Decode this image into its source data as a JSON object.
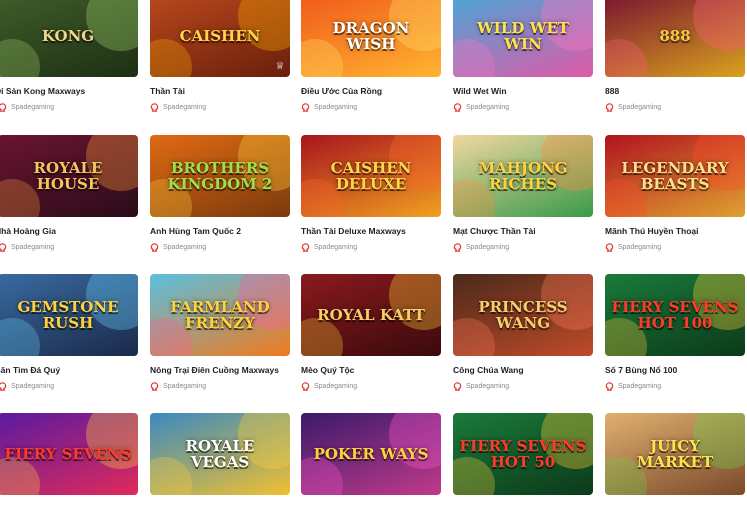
{
  "provider_label": "Spadegaming",
  "games": [
    {
      "name": "Di Sản Kong Maxways",
      "title": "KONG",
      "bg": "#3f5d2a",
      "bg2": "#1e2f14",
      "fg": "#f1d58a",
      "accent": "#9fd06a"
    },
    {
      "name": "Thần Tài",
      "title": "CAISHEN",
      "bg": "#b9481c",
      "bg2": "#6a1f0c",
      "fg": "#ffd54a",
      "accent": "#ffb000"
    },
    {
      "name": "Điều Ước Của Rồng",
      "title": "DRAGON WISH",
      "bg": "#f05a1a",
      "bg2": "#ffb431",
      "fg": "#ffffff",
      "accent": "#ffe46b"
    },
    {
      "name": "Wild Wet Win",
      "title": "WILD WET WIN",
      "bg": "#4aa6d8",
      "bg2": "#e05aa8",
      "fg": "#ffe34a",
      "accent": "#ff77c0"
    },
    {
      "name": "888",
      "title": "888",
      "bg": "#7a1430",
      "bg2": "#d8a21e",
      "fg": "#f5c84a",
      "accent": "#ff5e7a"
    },
    {
      "name": "Nhà Hoàng Gia",
      "title": "ROYALE HOUSE",
      "bg": "#6a1430",
      "bg2": "#2a0c1a",
      "fg": "#f3c75a",
      "accent": "#ff9a3a"
    },
    {
      "name": "Anh Hùng Tam Quốc 2",
      "title": "BROTHERS KINGDOM 2",
      "bg": "#e06a14",
      "bg2": "#7a3a0c",
      "fg": "#9fe04a",
      "accent": "#ffd23a"
    },
    {
      "name": "Thần Tài Deluxe Maxways",
      "title": "CAISHEN DELUXE",
      "bg": "#a8141e",
      "bg2": "#f0a020",
      "fg": "#ffd54a",
      "accent": "#ff6a2a"
    },
    {
      "name": "Mạt Chược Thần Tài",
      "title": "MAHJONG RICHES",
      "bg": "#f0d8a0",
      "bg2": "#3a9a4a",
      "fg": "#ffd23a",
      "accent": "#ff8a3a"
    },
    {
      "name": "Mãnh Thú Huyền Thoại",
      "title": "LEGENDARY BEASTS",
      "bg": "#b0141e",
      "bg2": "#e0a030",
      "fg": "#ffe08a",
      "accent": "#ff4a2a"
    },
    {
      "name": "Săn Tìm Đá Quý",
      "title": "GEMSTONE RUSH",
      "bg": "#3a6aa0",
      "bg2": "#1a2a4a",
      "fg": "#ffd23a",
      "accent": "#6ad0ff"
    },
    {
      "name": "Nông Trại Điên Cuồng Maxways",
      "title": "FARMLAND FRENZY",
      "bg": "#5ac0e0",
      "bg2": "#f07a1e",
      "fg": "#ffd23a",
      "accent": "#ff5aa0"
    },
    {
      "name": "Mèo Quý Tộc",
      "title": "ROYAL KATT",
      "bg": "#8a1a1e",
      "bg2": "#3a0a0c",
      "fg": "#f5d06a",
      "accent": "#ffcc33"
    },
    {
      "name": "Công Chúa Wang",
      "title": "PRINCESS WANG",
      "bg": "#4a2a1a",
      "bg2": "#c04a2a",
      "fg": "#f5d06a",
      "accent": "#ff7a5a"
    },
    {
      "name": "Số 7 Bùng Nổ 100",
      "title": "FIERY SEVENS HOT 100",
      "bg": "#1a7a3a",
      "bg2": "#0c3a1a",
      "fg": "#ff3a2a",
      "accent": "#ffd23a"
    },
    {
      "name": "",
      "title": "FIERY SEVENS",
      "bg": "#5a1aa0",
      "bg2": "#e02a5a",
      "fg": "#ff3a2a",
      "accent": "#ffd23a"
    },
    {
      "name": "",
      "title": "ROYALE VEGAS",
      "bg": "#3a8ac0",
      "bg2": "#f0c030",
      "fg": "#ffffff",
      "accent": "#ffd23a"
    },
    {
      "name": "",
      "title": "POKER WAYS",
      "bg": "#3a1a6a",
      "bg2": "#c03a8a",
      "fg": "#ffd23a",
      "accent": "#ff5ad0"
    },
    {
      "name": "",
      "title": "FIERY SEVENS HOT 50",
      "bg": "#1a7a3a",
      "bg2": "#0c3a1a",
      "fg": "#ff3a2a",
      "accent": "#ffd23a"
    },
    {
      "name": "",
      "title": "JUICY MARKET",
      "bg": "#e0b070",
      "bg2": "#7a4a2a",
      "fg": "#ffe34a",
      "accent": "#6ad04a"
    }
  ],
  "colors": {
    "provider_icon": "#e53935",
    "name_text": "#222222",
    "provider_text": "#8a8a8a"
  }
}
